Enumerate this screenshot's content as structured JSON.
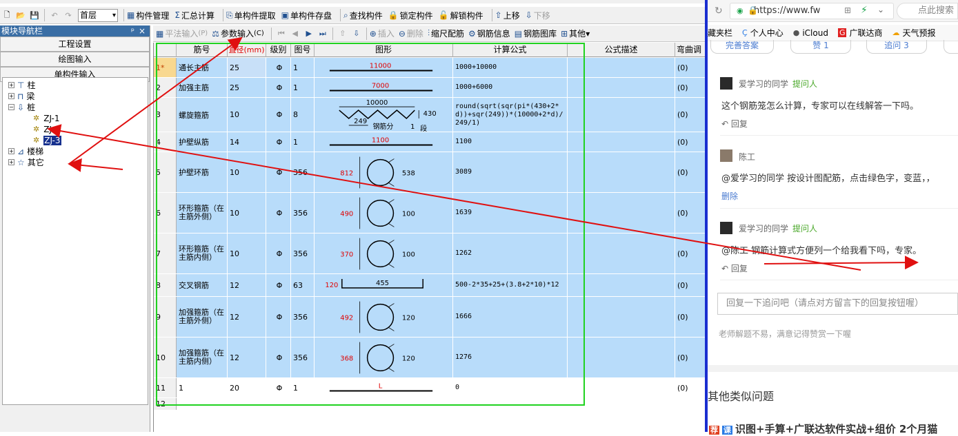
{
  "toolbar1": {
    "floor": "首层",
    "component_manage": "构件管理",
    "summary_calc": "汇总计算",
    "single_extract": "单构件提取",
    "single_save": "单构件存盘",
    "find_component": "查找构件",
    "lock_component": "锁定构件",
    "unlock_component": "解锁构件",
    "move_up": "上移",
    "move_down": "下移"
  },
  "nav": {
    "title": "模块导航栏",
    "pin": "ᵖ",
    "close": "×",
    "btn_project": "工程设置",
    "btn_draw": "绘图输入",
    "btn_single": "单构件输入",
    "tree": {
      "column": "柱",
      "beam": "梁",
      "pile": "桩",
      "zj1": "ZJ-1",
      "zj2": "ZJ-2",
      "zj3": "ZJ-3",
      "stairs": "楼梯",
      "other": "其它"
    }
  },
  "toolbar2": {
    "flat_input": "平法输入",
    "flat_key": "(P)",
    "param_input": "参数输入",
    "param_key": "(C)",
    "insert": "插入",
    "delete": "删除",
    "scale_rebar": "缩尺配筋",
    "rebar_info": "钢筋信息",
    "rebar_lib": "钢筋图库",
    "other": "其他"
  },
  "grid": {
    "headers": {
      "bar_no": "筋号",
      "diameter": "直径(mm)",
      "grade": "级别",
      "fig_no": "图号",
      "shape": "图形",
      "formula": "计算公式",
      "formula_desc": "公式描述",
      "bend": "弯曲调"
    },
    "rows": [
      {
        "rn": "1*",
        "name": "通长主筋",
        "dia": "25",
        "grade": "Φ",
        "fig": "1",
        "shape_label": "11000",
        "formula": "1000+10000",
        "bend": "(0)"
      },
      {
        "rn": "2",
        "name": "加强主筋",
        "dia": "25",
        "grade": "Φ",
        "fig": "1",
        "shape_label": "7000",
        "formula": "1000+6000",
        "bend": "(0)"
      },
      {
        "rn": "3",
        "name": "螺旋箍筋",
        "dia": "10",
        "grade": "Φ",
        "fig": "8",
        "shape_label": "10000",
        "shape_label2": "249",
        "shape_label3": "430",
        "shape_label4": "钢筋分",
        "shape_label5": "1",
        "shape_label6": "段",
        "formula": "round(sqrt(sqr(pi*(430+2*d))+sqr(249))*(10000+2*d)/249/1)",
        "bend": "(0)"
      },
      {
        "rn": "4",
        "name": "护壁纵筋",
        "dia": "14",
        "grade": "Φ",
        "fig": "1",
        "shape_label": "1100",
        "formula": "1100",
        "bend": "(0)"
      },
      {
        "rn": "5",
        "name": "护壁环筋",
        "dia": "10",
        "grade": "Φ",
        "fig": "356",
        "shape_label": "812",
        "shape_label2": "538",
        "formula": "3089",
        "bend": "(0)"
      },
      {
        "rn": "6",
        "name": "环形箍筋（在主筋外侧）",
        "dia": "10",
        "grade": "Φ",
        "fig": "356",
        "shape_label": "490",
        "shape_label2": "100",
        "formula": "1639",
        "bend": "(0)"
      },
      {
        "rn": "7",
        "name": "环形箍筋（在主筋内侧）",
        "dia": "10",
        "grade": "Φ",
        "fig": "356",
        "shape_label": "370",
        "shape_label2": "100",
        "formula": "1262",
        "bend": "(0)"
      },
      {
        "rn": "8",
        "name": "交叉钢筋",
        "dia": "12",
        "grade": "Φ",
        "fig": "63",
        "shape_label": "120",
        "shape_label2": "455",
        "formula": "500-2*35+25+(3.8+2*10)*12",
        "bend": "(0)"
      },
      {
        "rn": "9",
        "name": "加强箍筋（在主筋外侧）",
        "dia": "12",
        "grade": "Φ",
        "fig": "356",
        "shape_label": "492",
        "shape_label2": "120",
        "formula": "1666",
        "bend": "(0)"
      },
      {
        "rn": "10",
        "name": "加强箍筋（在主筋内侧）",
        "dia": "12",
        "grade": "Φ",
        "fig": "356",
        "shape_label": "368",
        "shape_label2": "120",
        "formula": "1276",
        "bend": "(0)"
      },
      {
        "rn": "11",
        "name": "1",
        "dia": "20",
        "grade": "Φ",
        "fig": "1",
        "shape_label": "L",
        "formula": "0",
        "bend": "(0)"
      },
      {
        "rn": "12",
        "name": "",
        "dia": "",
        "grade": "",
        "fig": "",
        "shape_label": "",
        "formula": "",
        "bend": ""
      }
    ]
  },
  "browser": {
    "url": "https://www.fw",
    "search_placeholder": "点此搜索",
    "bookmarks": [
      "藏夹栏",
      "个人中心",
      "iCloud",
      "广联达商",
      "天气预报"
    ],
    "pills": [
      "完善答案",
      "赞 1",
      "追问 3"
    ],
    "comments": [
      {
        "user": "爱学习的同学",
        "tag": "提问人",
        "text": "这个钢筋笼怎么计算，专家可以在线解答一下吗。",
        "reply": "回复"
      },
      {
        "user": "陈工",
        "tag": "",
        "text": "@爱学习的同学  按设计图配筋，点击绿色字，变蓝，，",
        "reply": "删除"
      },
      {
        "user": "爱学习的同学",
        "tag": "提问人",
        "text": "@陈工  钢筋计算式方便列一个给我看下吗，专家。",
        "reply": "回复"
      }
    ],
    "reply_placeholder": "回复一下追问吧（请点对方留言下的回复按钮喔）",
    "tip": "老师解题不易，满意记得赞赏一下喔",
    "other_title": "其他类似问题",
    "bottom_link": "识图+手算+广联达软件实战+组价 2个月猫"
  }
}
